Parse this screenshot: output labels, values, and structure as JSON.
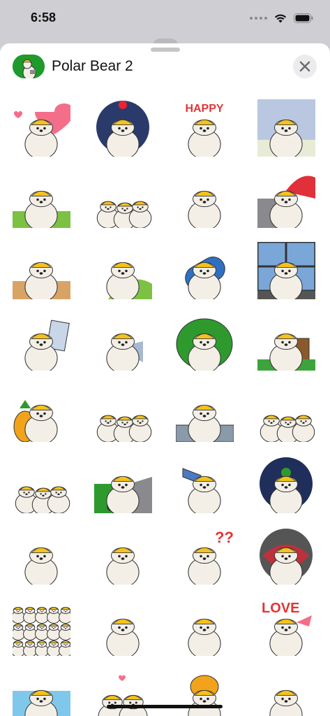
{
  "status_bar": {
    "time": "6:58"
  },
  "header": {
    "title": "Polar Bear 2",
    "close_icon": "xmark-icon"
  },
  "colors": {
    "accent": "#1f9a2c",
    "bear": "#f3efe6",
    "hat": "#f5c21b",
    "heart": "#f46e8a"
  },
  "stickers": [
    {
      "name": "sticker-bear-heart",
      "bg": "heart"
    },
    {
      "name": "sticker-bear-blanket-blue",
      "bg": "night"
    },
    {
      "name": "sticker-bear-happy",
      "bg": "happy"
    },
    {
      "name": "sticker-bear-money",
      "bg": "money"
    },
    {
      "name": "sticker-bear-pointing-grass",
      "bg": "grass"
    },
    {
      "name": "sticker-bear-trio",
      "bg": "none"
    },
    {
      "name": "sticker-bear-dancing",
      "bg": "none"
    },
    {
      "name": "sticker-bear-umbrella",
      "bg": "umbrella"
    },
    {
      "name": "sticker-bear-lying",
      "bg": "desert"
    },
    {
      "name": "sticker-bear-hearts-hill",
      "bg": "hill"
    },
    {
      "name": "sticker-bear-sleeping-bag",
      "bg": "sleepbag"
    },
    {
      "name": "sticker-bear-window",
      "bg": "window"
    },
    {
      "name": "sticker-bear-paper",
      "bg": "paper"
    },
    {
      "name": "sticker-bear-fish",
      "bg": "fish"
    },
    {
      "name": "sticker-bear-bush",
      "bg": "bush"
    },
    {
      "name": "sticker-bear-stump",
      "bg": "stump"
    },
    {
      "name": "sticker-bear-pineapple",
      "bg": "pineapple"
    },
    {
      "name": "sticker-bear-pizza-trio",
      "bg": "none"
    },
    {
      "name": "sticker-bear-table",
      "bg": "table"
    },
    {
      "name": "sticker-bear-ducks",
      "bg": "none"
    },
    {
      "name": "sticker-bear-group-arms",
      "bg": "none"
    },
    {
      "name": "sticker-bear-segway",
      "bg": "segway"
    },
    {
      "name": "sticker-bear-horn",
      "bg": "horn"
    },
    {
      "name": "sticker-bear-space",
      "bg": "space"
    },
    {
      "name": "sticker-bear-big-face",
      "bg": "none"
    },
    {
      "name": "sticker-bear-back",
      "bg": "none"
    },
    {
      "name": "sticker-bear-question",
      "bg": "question"
    },
    {
      "name": "sticker-bear-monster",
      "bg": "monster"
    },
    {
      "name": "sticker-bear-crowd",
      "bg": "crowd"
    },
    {
      "name": "sticker-bear-red-ball",
      "bg": "none"
    },
    {
      "name": "sticker-bear-sitting",
      "bg": "none"
    },
    {
      "name": "sticker-bear-love",
      "bg": "love"
    },
    {
      "name": "sticker-bear-water",
      "bg": "water"
    },
    {
      "name": "sticker-bear-kiss",
      "bg": "kiss"
    },
    {
      "name": "sticker-bear-orange-cat",
      "bg": "cat"
    },
    {
      "name": "sticker-bear-standing",
      "bg": "none"
    }
  ]
}
